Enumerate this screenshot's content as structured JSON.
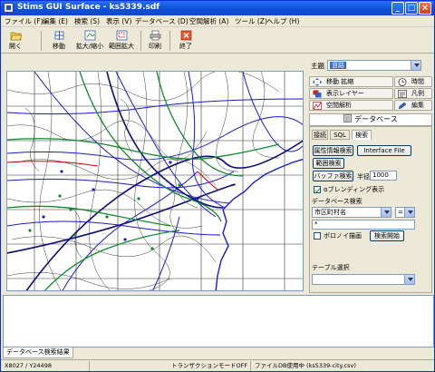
{
  "titlebar": {
    "title": "Stims GUI Surface - ks5339.sdf",
    "minimize": "_",
    "maximize": "□",
    "close": "×"
  },
  "menu": [
    "ファイル (F)",
    "編集 (E)",
    "検索 (S)",
    "表示 (V)",
    "データベース (D)",
    "空間解析 (A)",
    "ツール (Z)",
    "ヘルプ (H)"
  ],
  "toolbar": {
    "open": "開く",
    "move": "移動",
    "zoom": "拡大/縮小",
    "range_zoom": "範囲拡大",
    "print": "印刷",
    "exit": "終了"
  },
  "right_panel": {
    "theme_label": "主題",
    "theme_value": "道路",
    "tabs": {
      "move_zoom": "移動 拡縮",
      "time": "時間",
      "layer_display": "表示レイヤー",
      "legend": "凡例",
      "spatial_analysis": "空間解析",
      "edit": "編集"
    },
    "db_header": "データベース",
    "subtabs": [
      "接続",
      "SQL",
      "検索"
    ],
    "buttons": {
      "attr_search": "属性情報検索",
      "interface_file": "Interface File",
      "range_search": "範囲検索",
      "buffer_search": "バッファ検索",
      "exec_search": "検索開始"
    },
    "radius_label": "半径",
    "radius_value": "1000",
    "alpha_blend": "αブレンディング表示",
    "db_search_label": "データベース検索",
    "field_select": "市区町村名",
    "operator_select": "=",
    "search_value": "*",
    "voronoi": "ボロノイ描画",
    "table_select_label": "テーブル選択",
    "table_select_value": ""
  },
  "bottom": {
    "results_tab": "データベース検索結果"
  },
  "status": {
    "coords": "X8027 / Y24498",
    "transaction": "トランザクションモードOFF",
    "filedb": "ファイルDB使用中 (ks5339-city.csv)"
  },
  "colors": {
    "title_blue": "#0a4fd6",
    "road_blue": "#1a1ad0",
    "road_navy": "#0b0b7a",
    "road_green": "#118a2e",
    "boundary": "#333333",
    "rail_red": "#cc0000"
  }
}
